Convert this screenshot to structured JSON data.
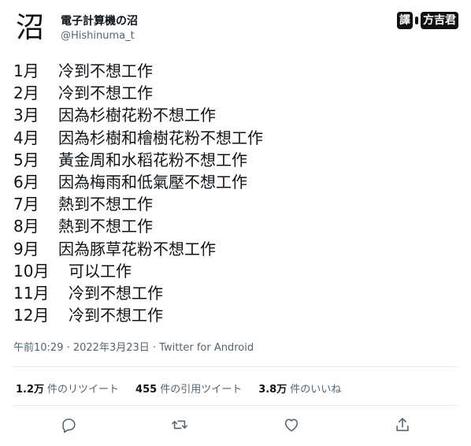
{
  "header": {
    "avatar_char": "沼",
    "display_name": "電子計算機の沼",
    "handle": "@Hishinuma_t",
    "watermark": {
      "left": "譯",
      "right": "方吉君"
    }
  },
  "tweet": {
    "lines": [
      {
        "month": "1月",
        "text": "冷到不想工作"
      },
      {
        "month": "2月",
        "text": "冷到不想工作"
      },
      {
        "month": "3月",
        "text": "因為杉樹花粉不想工作"
      },
      {
        "month": "4月",
        "text": "因為杉樹和檜樹花粉不想工作"
      },
      {
        "month": "5月",
        "text": "黃金周和水稻花粉不想工作"
      },
      {
        "month": "6月",
        "text": "因為梅雨和低氣壓不想工作"
      },
      {
        "month": "7月",
        "text": "熱到不想工作"
      },
      {
        "month": "8月",
        "text": "熱到不想工作"
      },
      {
        "month": "9月",
        "text": "因為豚草花粉不想工作"
      },
      {
        "month": "10月",
        "text": "可以工作"
      },
      {
        "month": "11月",
        "text": "冷到不想工作"
      },
      {
        "month": "12月",
        "text": "冷到不想工作"
      }
    ],
    "timestamp": "午前10:29 · 2022年3月23日 · Twitter for Android"
  },
  "stats": {
    "retweets": {
      "count": "1.2万",
      "label": "件のリツイート"
    },
    "quotes": {
      "count": "455",
      "label": "件の引用ツイート"
    },
    "likes": {
      "count": "3.8万",
      "label": "件のいいね"
    }
  },
  "actions": [
    "reply-icon",
    "retweet-icon",
    "like-icon",
    "share-icon"
  ]
}
